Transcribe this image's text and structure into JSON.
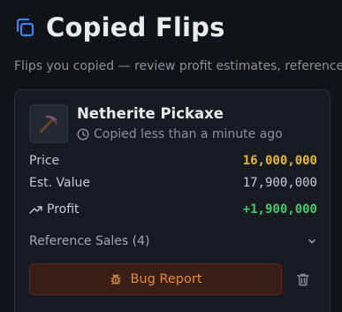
{
  "header": {
    "title": "Copied Flips",
    "icon": "copy-icon",
    "subtitle": "Flips you copied — review profit estimates, references, and report issues."
  },
  "card": {
    "item_name": "Netherite Pickaxe",
    "item_icon": "pickaxe-icon",
    "copied_text": "Copied less than a minute ago",
    "stats": {
      "price_label": "Price",
      "price_value": "16,000,000",
      "est_label": "Est. Value",
      "est_value": "17,900,000",
      "profit_label": "Profit",
      "profit_value": "+1,900,000"
    },
    "reference_label": "Reference Sales (4)",
    "bug_report_label": "Bug Report"
  },
  "colors": {
    "background": "#111318",
    "card": "#171a21",
    "accent_blue": "#3b82f6",
    "price": "#e5b730",
    "profit": "#3ecb6e",
    "bug_text": "#e18a3a"
  }
}
